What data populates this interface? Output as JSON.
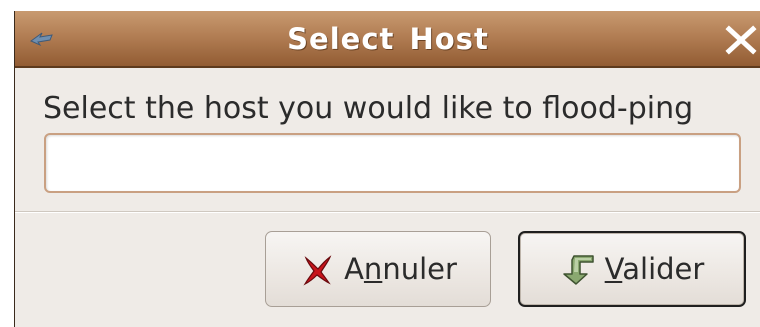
{
  "window": {
    "title": "Select  Host",
    "close_label": "Close"
  },
  "dialog": {
    "prompt": "Select the host you would like to flood-ping",
    "input": {
      "value": "",
      "placeholder": ""
    }
  },
  "buttons": {
    "cancel": {
      "label_before": "A",
      "mnemonic": "n",
      "label_after": "nuler",
      "icon": "red-x-icon"
    },
    "ok": {
      "label_before": "",
      "mnemonic": "V",
      "label_after": "alider",
      "icon": "green-arrow-icon"
    }
  },
  "colors": {
    "titlebar": "#b27e54",
    "window_bg": "#efebe7",
    "input_border": "#c9a082"
  }
}
